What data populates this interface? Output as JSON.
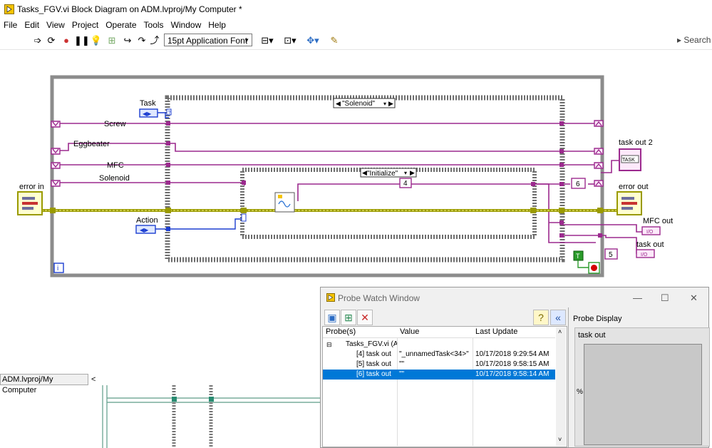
{
  "window": {
    "title": "Tasks_FGV.vi Block Diagram on ADM.lvproj/My Computer *"
  },
  "menu": [
    "File",
    "Edit",
    "View",
    "Project",
    "Operate",
    "Tools",
    "Window",
    "Help"
  ],
  "toolbar": {
    "font": "15pt Application Font",
    "search_placeholder": "Search"
  },
  "diagram": {
    "labels": {
      "task": "Task",
      "screw": "Screw",
      "eggbeater": "Eggbeater",
      "mfc": "MFC",
      "solenoid": "Solenoid",
      "error_in": "error in",
      "action": "Action",
      "task_out_2": "task out 2",
      "error_out": "error out",
      "mfc_out": "MFC out",
      "task_out": "task out"
    },
    "case_outer": "\"Solenoid\"",
    "case_inner": "\"Initialize\"",
    "const_4": "4",
    "const_6": "6",
    "const_5": "5",
    "const_true": "T",
    "task_indicator": "TASK",
    "io_indicator": "I/O",
    "iteration": "i"
  },
  "project_tab": "ADM.lvproj/My Computer",
  "probe_window": {
    "title": "Probe Watch Window",
    "columns": [
      "Probe(s)",
      "Value",
      "Last Update"
    ],
    "group": "Tasks_FGV.vi (A",
    "rows": [
      {
        "probe": "[4] task out",
        "value": "\"_unnamedTask<34>\"",
        "last_update": "10/17/2018 9:29:54 AM"
      },
      {
        "probe": "[5] task out",
        "value": "\"\"",
        "last_update": "10/17/2018 9:58:15 AM"
      },
      {
        "probe": "[6] task out",
        "value": "\"\"",
        "last_update": "10/17/2018 9:58:14 AM"
      }
    ],
    "display_title": "Probe Display",
    "display_label": "task out",
    "display_unit": "%"
  },
  "colors": {
    "task_wire": "#9c2a8e",
    "error_wire": "#b3b300",
    "enum_wire": "#1d3fd1",
    "selection": "#0078d7"
  }
}
